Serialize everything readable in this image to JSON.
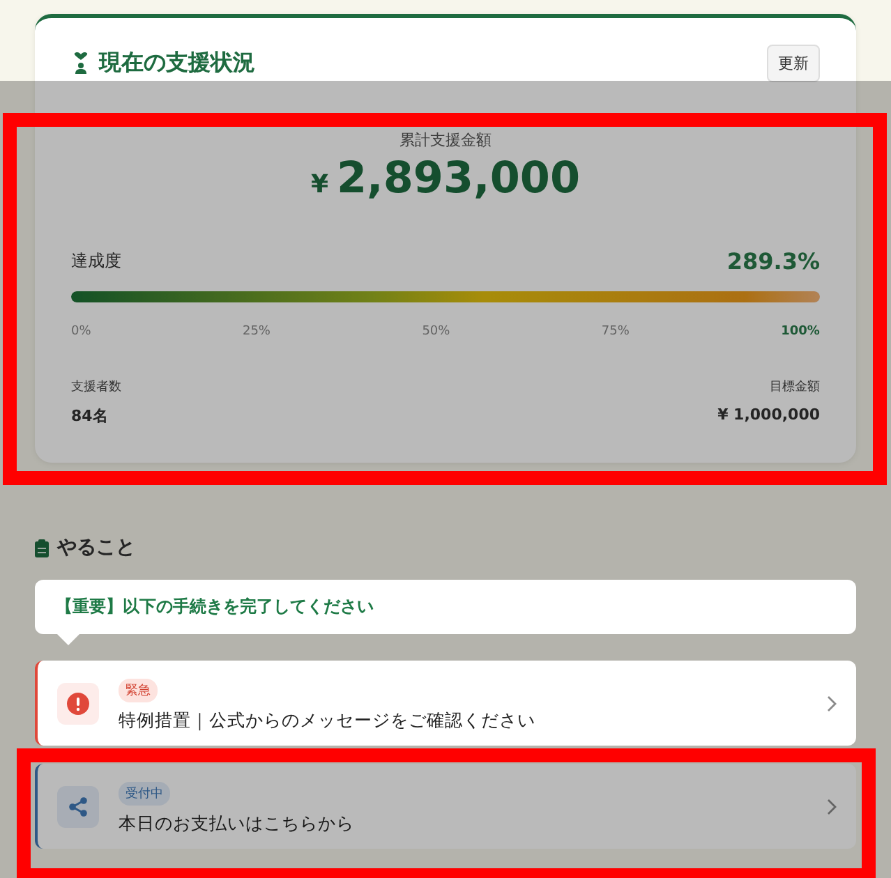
{
  "status_card": {
    "title": "現在の支援状況",
    "refresh_button": "更新",
    "total_label": "累計支援金額",
    "currency": "¥",
    "total": "2,893,000",
    "progress_label": "達成度",
    "progress_value": "289.3%",
    "level": 1,
    "scale": [
      {
        "label": "0%",
        "reached": false
      },
      {
        "label": "25%",
        "reached": false
      },
      {
        "label": "50%",
        "reached": false
      },
      {
        "label": "75%",
        "reached": false
      },
      {
        "label": "100%",
        "reached": true
      }
    ],
    "supporters_label": "支援者数",
    "supporters": "84名",
    "goal_label": "目標金額",
    "goal": "¥ 1,000,000",
    "highlighted": true
  },
  "overlay": {
    "dimmed": true
  },
  "todo": {
    "title": "やること",
    "tooltip": "【重要】以下の手続きを完了してください",
    "tasks": [
      {
        "kind": "urgent",
        "badge": "緊急",
        "title": "特例措置｜公式からのメッセージをご確認ください",
        "spotlight": true,
        "highlighted": false
      },
      {
        "kind": "open",
        "badge": "受付中",
        "title": "本日のお支払いはこちらから",
        "spotlight": false,
        "highlighted": true
      }
    ]
  }
}
